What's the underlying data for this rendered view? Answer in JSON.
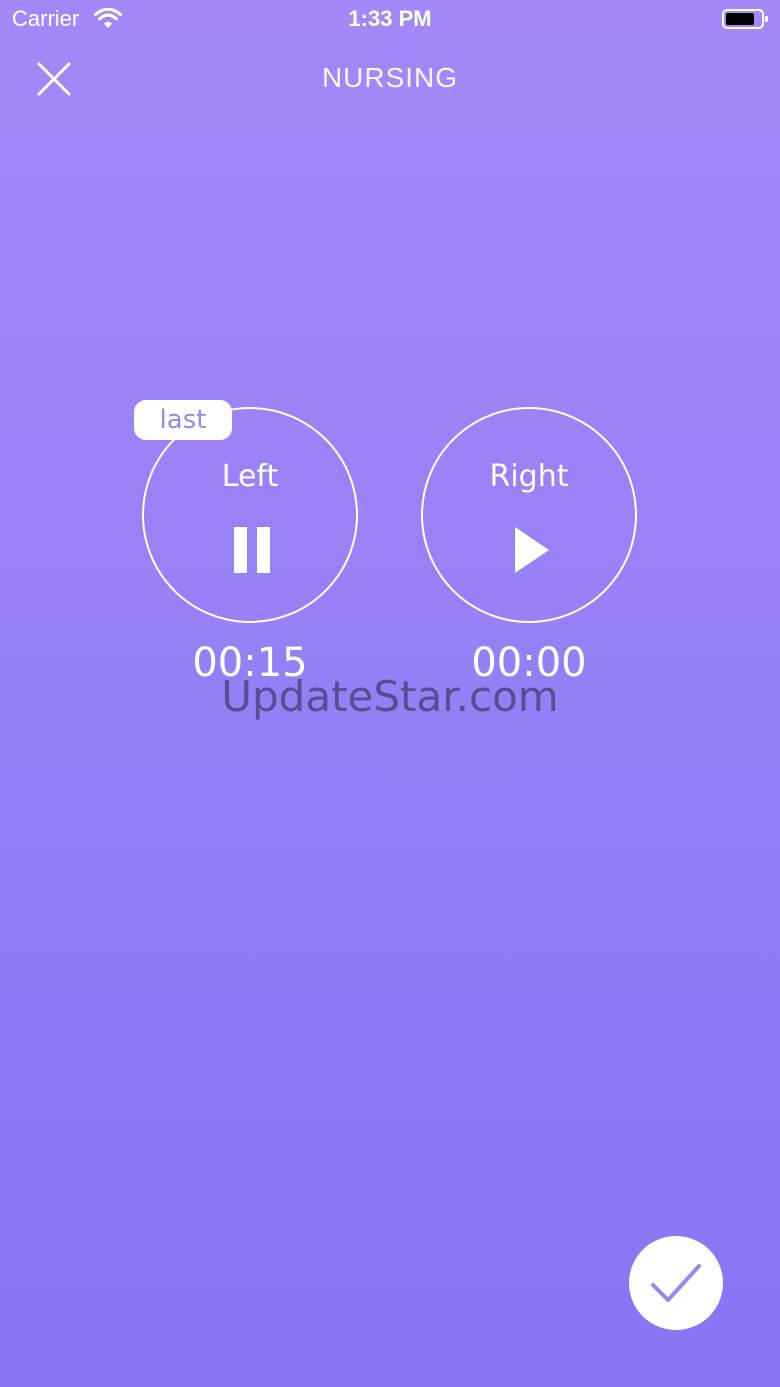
{
  "status_bar": {
    "carrier": "Carrier",
    "time": "1:33 PM"
  },
  "header": {
    "title": "NURSING",
    "close_icon": "close-icon"
  },
  "sides": {
    "left": {
      "label": "Left",
      "timer": "00:15",
      "badge": "last",
      "state_icon": "pause-icon"
    },
    "right": {
      "label": "Right",
      "timer": "00:00",
      "state_icon": "play-icon"
    }
  },
  "watermark": "UpdateStar.com",
  "confirm": {
    "icon": "checkmark-icon"
  },
  "colors": {
    "background_top": "#a289f7",
    "background_bottom": "#8875f4",
    "accent": "#9b85f3",
    "foreground": "#ffffff"
  }
}
